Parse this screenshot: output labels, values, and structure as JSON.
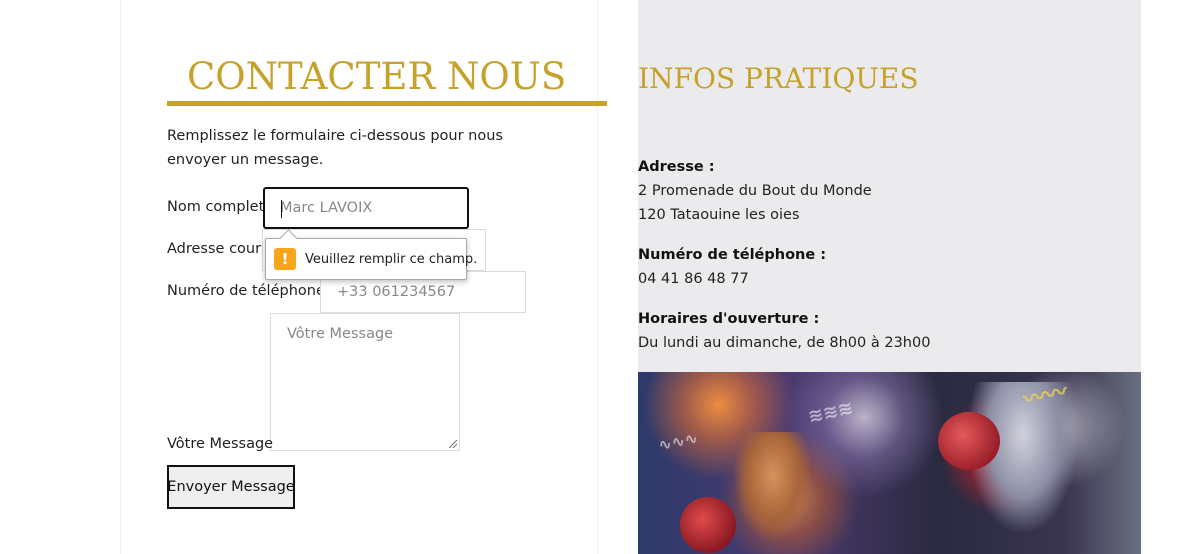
{
  "contact": {
    "title": "CONTACTER NOUS",
    "intro": "Remplissez le formulaire ci-dessous pour nous envoyer un message.",
    "name_label": "Nom complet",
    "name_placeholder": "Marc LAVOIX",
    "email_label": "Adresse courri",
    "phone_label": "Numéro de téléphone",
    "phone_placeholder": "+33  061234567",
    "message_label": "Vôtre Message",
    "message_placeholder": "Vôtre Message",
    "submit_label": "Envoyer Message",
    "validation": {
      "icon": "warning-icon",
      "icon_glyph": "!",
      "message": "Veuillez remplir ce champ.",
      "color": "#f7a51c"
    }
  },
  "infos": {
    "title": "INFOS PRATIQUES",
    "address_label": "Adresse :",
    "address_line1": "2 Promenade du Bout du Monde",
    "address_line2": "120 Tataouine les oies",
    "phone_label": "Numéro de téléphone :",
    "phone_value": "04 41 86 48 77",
    "hours_label": "Horaires d'ouverture :",
    "hours_value": "Du lundi au dimanche, de 8h00 à 23h00"
  },
  "colors": {
    "accent_gold": "#c6a22b",
    "info_background": "#ebebed"
  }
}
